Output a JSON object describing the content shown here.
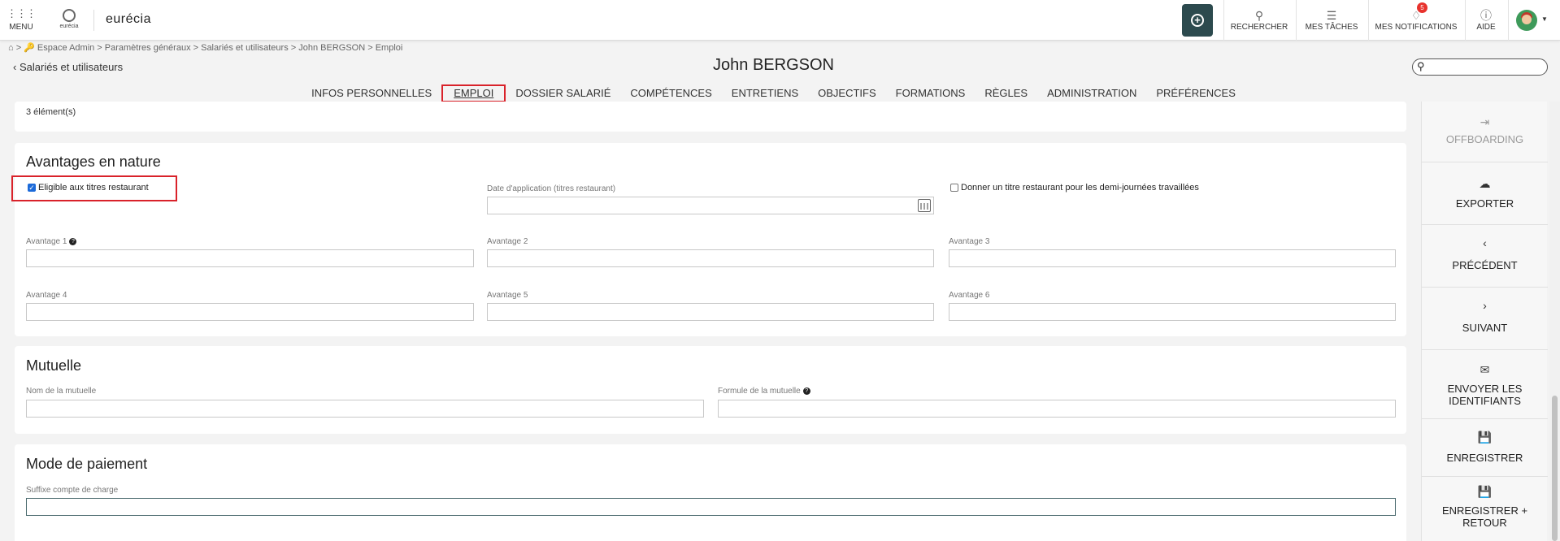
{
  "topbar": {
    "menu_label": "MENU",
    "logo_text": "eurécia",
    "brand": "eurécia",
    "items": [
      {
        "icon": "search-icon",
        "label": "RECHERCHER"
      },
      {
        "icon": "tasks-icon",
        "label": "MES TÂCHES"
      },
      {
        "icon": "bell-icon",
        "label": "MES NOTIFICATIONS",
        "badge": "5"
      },
      {
        "icon": "help-icon",
        "label": "AIDE"
      }
    ]
  },
  "breadcrumb": "⌂ >  🔑 Espace Admin > Paramètres généraux > Salariés et utilisateurs > John BERGSON > Emploi",
  "back_link": "Salariés et utilisateurs",
  "page_title": "John BERGSON",
  "tabs": [
    {
      "label": "INFOS PERSONNELLES"
    },
    {
      "label": "EMPLOI",
      "active": true
    },
    {
      "label": "DOSSIER SALARIÉ"
    },
    {
      "label": "COMPÉTENCES"
    },
    {
      "label": "ENTRETIENS"
    },
    {
      "label": "OBJECTIFS"
    },
    {
      "label": "FORMATIONS"
    },
    {
      "label": "RÈGLES"
    },
    {
      "label": "ADMINISTRATION"
    },
    {
      "label": "PRÉFÉRENCES"
    }
  ],
  "items_count": "3 élément(s)",
  "avantages": {
    "title": "Avantages en nature",
    "eligible_label": "Eligible aux titres restaurant",
    "eligible_checked": true,
    "date_label": "Date d'application (titres restaurant)",
    "date_value": "",
    "half_day_label": "Donner un titre restaurant pour les demi-journées travaillées",
    "half_day_checked": false,
    "fields": [
      {
        "label": "Avantage 1",
        "value": ""
      },
      {
        "label": "Avantage 2",
        "value": ""
      },
      {
        "label": "Avantage 3",
        "value": ""
      },
      {
        "label": "Avantage 4",
        "value": ""
      },
      {
        "label": "Avantage 5",
        "value": ""
      },
      {
        "label": "Avantage 6",
        "value": ""
      }
    ]
  },
  "mutuelle": {
    "title": "Mutuelle",
    "name_label": "Nom de la mutuelle",
    "name_value": "",
    "formula_label": "Formule de la mutuelle",
    "formula_value": ""
  },
  "paiement": {
    "title": "Mode de paiement",
    "suffix_label": "Suffixe compte de charge",
    "suffix_value": ""
  },
  "actions": [
    {
      "icon": "logout-icon",
      "label": "OFFBOARDING",
      "disabled": true
    },
    {
      "icon": "cloud-upload-icon",
      "label": "EXPORTER"
    },
    {
      "icon": "chevron-left-icon",
      "label": "PRÉCÉDENT"
    },
    {
      "icon": "chevron-right-icon",
      "label": "SUIVANT"
    },
    {
      "icon": "envelope-icon",
      "label": "ENVOYER LES IDENTIFIANTS"
    },
    {
      "icon": "save-icon",
      "label": "ENREGISTRER"
    },
    {
      "icon": "save-plus-icon",
      "label": "ENREGISTRER + RETOUR"
    }
  ],
  "colors": {
    "accent": "#2c4a4e",
    "highlight": "#d9222a",
    "badge": "#e8322d",
    "checkbox": "#1c6ad9"
  }
}
